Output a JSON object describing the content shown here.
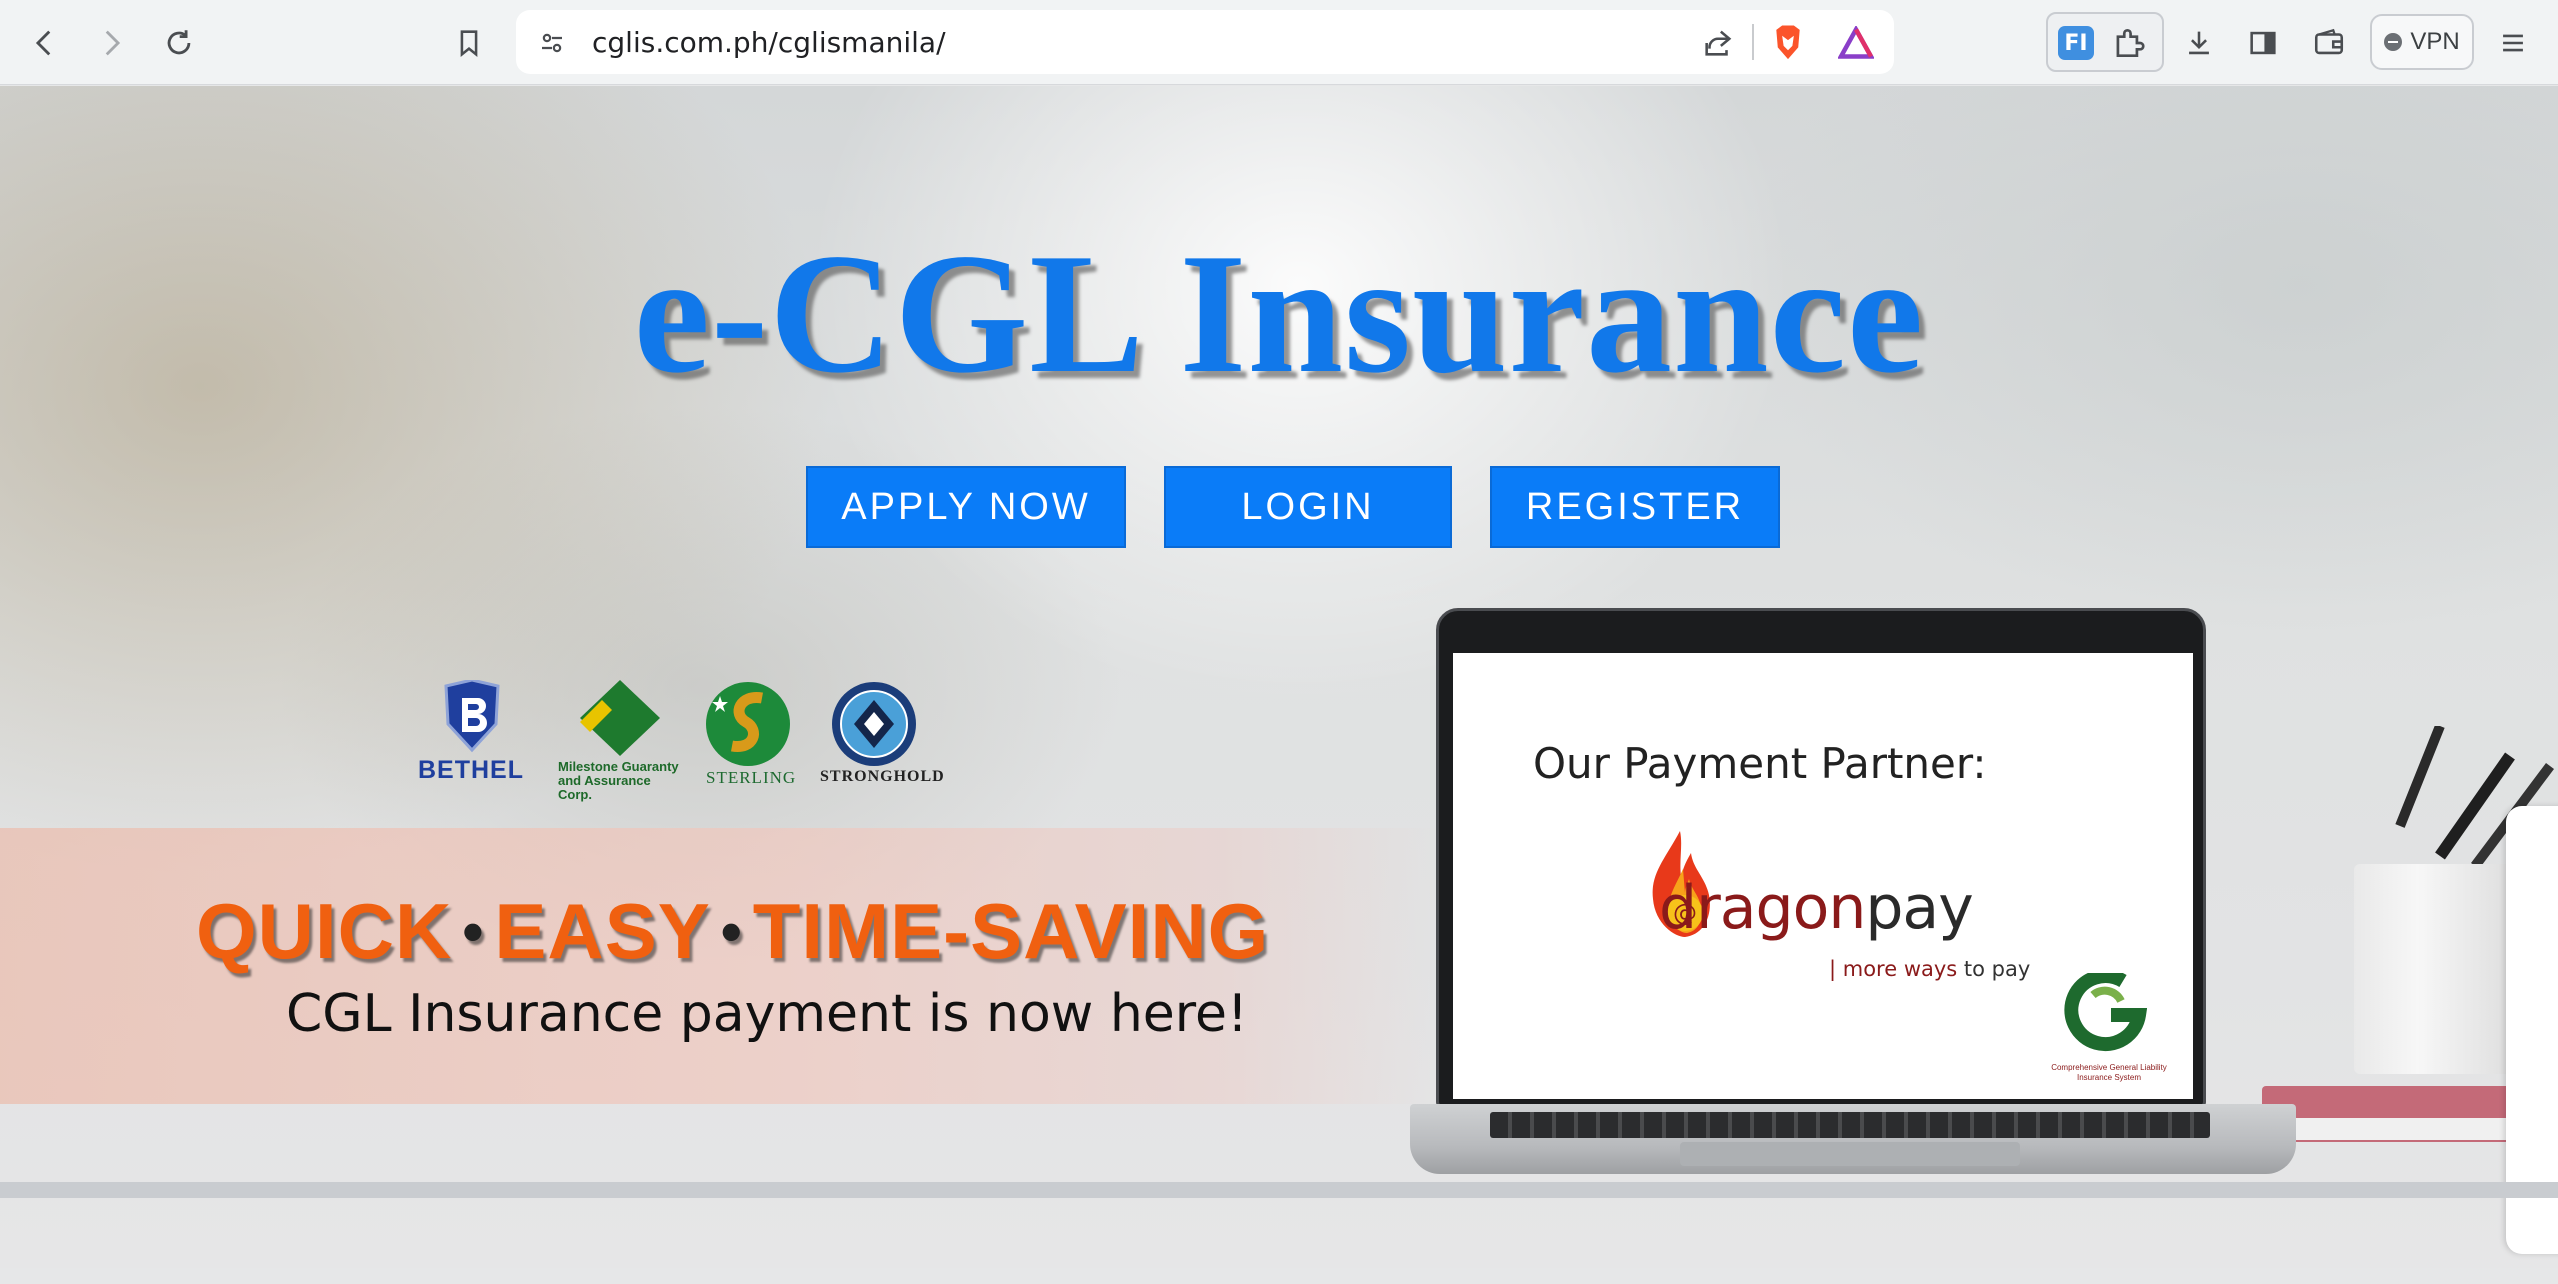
{
  "browser": {
    "url": "cglis.com.ph/cglismanila/",
    "back_label": "Back",
    "forward_label": "Forward",
    "reload_label": "Reload",
    "vpn_label": "VPN",
    "extension_badge": "FI"
  },
  "hero": {
    "title": "e-CGL Insurance",
    "buttons": {
      "apply": "APPLY NOW",
      "login": "LOGIN",
      "register": "REGISTER"
    }
  },
  "partners": [
    {
      "name": "BETHEL"
    },
    {
      "name": "Milestone Guaranty and Assurance Corp."
    },
    {
      "name": "STERLING"
    },
    {
      "name": "STRONGHOLD"
    }
  ],
  "promo": {
    "word1": "QUICK",
    "word2": "EASY",
    "word3": "TIME-SAVING",
    "separator": "•",
    "subtitle": "CGL Insurance  payment is now here!"
  },
  "laptop": {
    "heading": "Our Payment Partner:",
    "brand_part1": "dragon",
    "brand_part2": "pay",
    "tagline_part1": "| more ways",
    "tagline_part2": " to pay",
    "cglis_caption": "Comprehensive General Liability Insurance System"
  },
  "colors": {
    "accent_blue": "#0a7cf8",
    "title_blue": "#1178ea",
    "promo_orange": "#f06010",
    "dragonpay_red": "#8a1a1a"
  }
}
